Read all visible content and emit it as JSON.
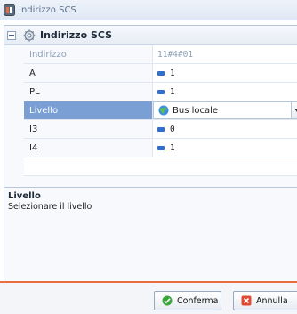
{
  "window": {
    "title": "Indirizzo SCS"
  },
  "group": {
    "title": "Indirizzo SCS"
  },
  "properties": [
    {
      "name": "Indirizzo",
      "value": "11#4#01",
      "readonly": true
    },
    {
      "name": "A",
      "value": "1",
      "icon": "numeric-icon"
    },
    {
      "name": "PL",
      "value": "1",
      "icon": "numeric-icon"
    },
    {
      "name": "Livello",
      "value": "Bus locale",
      "icon": "globe-icon",
      "selected": true
    },
    {
      "name": "I3",
      "value": "0",
      "icon": "numeric-icon"
    },
    {
      "name": "I4",
      "value": "1",
      "icon": "numeric-icon"
    }
  ],
  "description": {
    "title": "Livello",
    "text": "Selezionare il livello"
  },
  "buttons": {
    "confirm": "Conferma",
    "cancel": "Annulla"
  },
  "colors": {
    "accent_line": "#e86c3c",
    "selected_row": "#7a9fd4",
    "numeric_icon": "#2f6fcf"
  }
}
